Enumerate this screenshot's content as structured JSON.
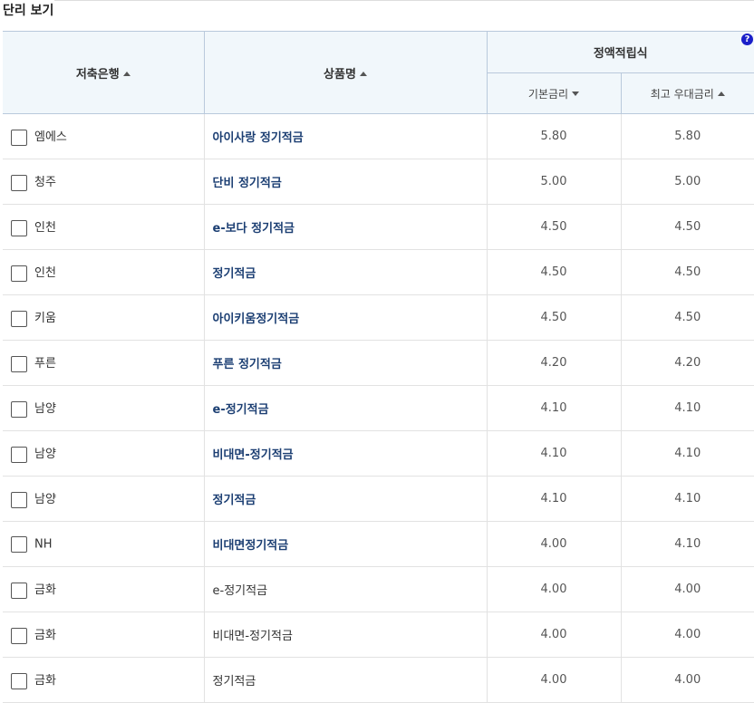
{
  "section_title": "단리 보기",
  "headers": {
    "bank": "저축은행",
    "product": "상품명",
    "group": "정액적립식",
    "basic_rate": "기본금리",
    "max_rate": "최고 우대금리",
    "help": "?"
  },
  "rows": [
    {
      "bank": "엠에스",
      "product": "아이사랑 정기적금",
      "linked": true,
      "basic": "5.80",
      "max": "5.80"
    },
    {
      "bank": "청주",
      "product": "단비 정기적금",
      "linked": true,
      "basic": "5.00",
      "max": "5.00"
    },
    {
      "bank": "인천",
      "product": "e-보다 정기적금",
      "linked": true,
      "basic": "4.50",
      "max": "4.50"
    },
    {
      "bank": "인천",
      "product": "정기적금",
      "linked": true,
      "basic": "4.50",
      "max": "4.50"
    },
    {
      "bank": "키움",
      "product": "아이키움정기적금",
      "linked": true,
      "basic": "4.50",
      "max": "4.50"
    },
    {
      "bank": "푸른",
      "product": "푸른 정기적금",
      "linked": true,
      "basic": "4.20",
      "max": "4.20"
    },
    {
      "bank": "남양",
      "product": "e-정기적금",
      "linked": true,
      "basic": "4.10",
      "max": "4.10"
    },
    {
      "bank": "남양",
      "product": "비대면-정기적금",
      "linked": true,
      "basic": "4.10",
      "max": "4.10"
    },
    {
      "bank": "남양",
      "product": "정기적금",
      "linked": true,
      "basic": "4.10",
      "max": "4.10"
    },
    {
      "bank": "NH",
      "product": "비대면정기적금",
      "linked": true,
      "basic": "4.00",
      "max": "4.10"
    },
    {
      "bank": "금화",
      "product": "e-정기적금",
      "linked": false,
      "basic": "4.00",
      "max": "4.00"
    },
    {
      "bank": "금화",
      "product": "비대면-정기적금",
      "linked": false,
      "basic": "4.00",
      "max": "4.00"
    },
    {
      "bank": "금화",
      "product": "정기적금",
      "linked": false,
      "basic": "4.00",
      "max": "4.00"
    }
  ],
  "colors": {
    "link": "#1c3f73",
    "header_bg": "#f1f7fb",
    "help_icon": "#1a1fc9"
  },
  "sort": {
    "bank": "asc",
    "product": "asc",
    "basic_rate": "desc",
    "max_rate": "asc"
  }
}
